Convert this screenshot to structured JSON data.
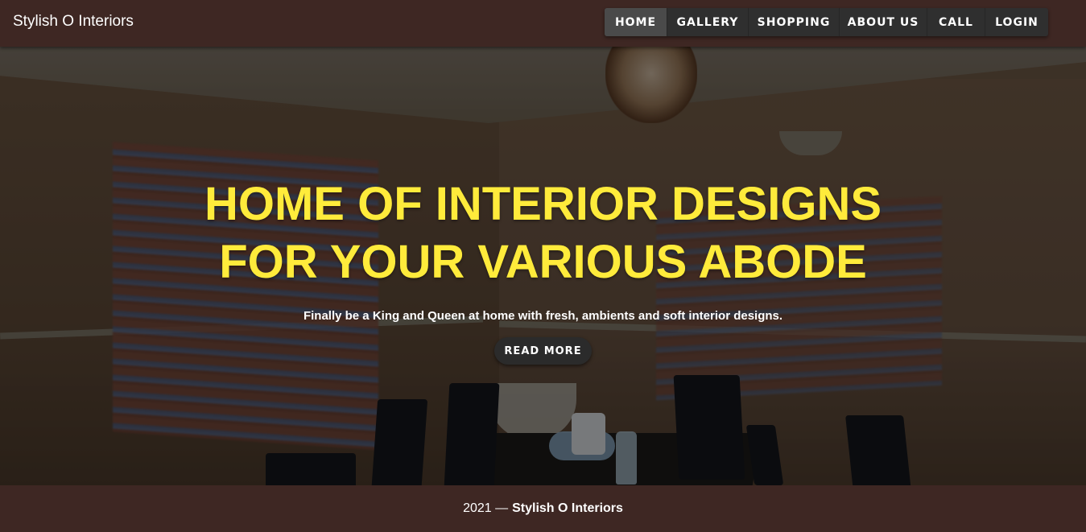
{
  "header": {
    "brand": "Stylish O Interiors",
    "nav": [
      {
        "label": "HOME",
        "active": true
      },
      {
        "label": "GALLERY",
        "active": false
      },
      {
        "label": "SHOPPING",
        "active": false
      },
      {
        "label": "ABOUT US",
        "active": false
      },
      {
        "label": "CALL",
        "active": false
      },
      {
        "label": "LOGIN",
        "active": false
      }
    ]
  },
  "hero": {
    "title_line1": "HOME OF INTERIOR DESIGNS",
    "title_line2": "FOR YOUR VARIOUS ABODE",
    "subtitle": "Finally be a King and Queen at home with fresh, ambients and soft interior designs.",
    "cta_label": "READ MORE"
  },
  "footer": {
    "year": "2021 —",
    "brand": "Stylish O Interiors"
  },
  "colors": {
    "bar_bg": "#3e2723",
    "title": "#ffeb3b",
    "nav_bg": "#2f2f2f",
    "nav_active": "#4a4a4a"
  }
}
